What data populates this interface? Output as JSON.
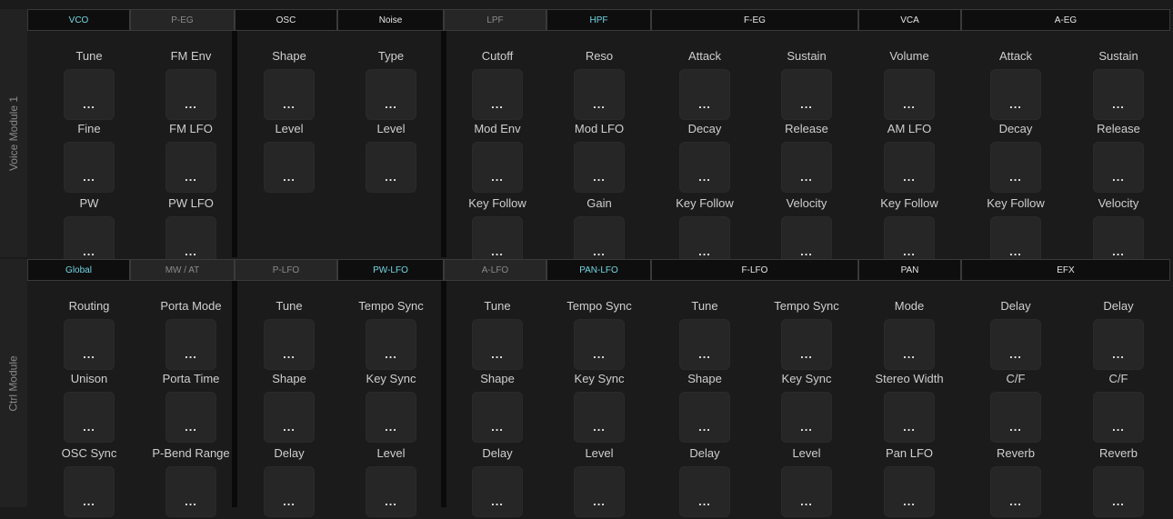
{
  "modules": [
    {
      "title": "Voice Module 1",
      "tabs": [
        {
          "label": "VCO",
          "style": "cyan"
        },
        {
          "label": "P-EG",
          "style": "dim"
        },
        {
          "label": "OSC",
          "style": "normal"
        },
        {
          "label": "Noise",
          "style": "normal"
        },
        {
          "label": "LPF",
          "style": "dim"
        },
        {
          "label": "HPF",
          "style": "cyan"
        },
        {
          "label": "F-EG",
          "style": "normal"
        },
        {
          "label": "VCA",
          "style": "normal"
        },
        {
          "label": "A-EG",
          "style": "normal"
        }
      ],
      "rows": [
        [
          "Tune",
          "FM Env",
          "Shape",
          "Type",
          "Cutoff",
          "Reso",
          "Attack",
          "Sustain",
          "Volume",
          "Attack",
          "Sustain"
        ],
        [
          "Fine",
          "FM LFO",
          "Level",
          "Level",
          "Mod Env",
          "Mod LFO",
          "Decay",
          "Release",
          "AM LFO",
          "Decay",
          "Release"
        ],
        [
          "PW",
          "PW LFO",
          "",
          "",
          "Key Follow",
          "Gain",
          "Key Follow",
          "Velocity",
          "Key Follow",
          "Key Follow",
          "Velocity"
        ]
      ]
    },
    {
      "title": "Ctrl Module",
      "tabs": [
        {
          "label": "Global",
          "style": "cyan"
        },
        {
          "label": "MW / AT",
          "style": "dim"
        },
        {
          "label": "P-LFO",
          "style": "dim"
        },
        {
          "label": "PW-LFO",
          "style": "cyan"
        },
        {
          "label": "A-LFO",
          "style": "dim"
        },
        {
          "label": "PAN-LFO",
          "style": "cyan"
        },
        {
          "label": "F-LFO",
          "style": "normal"
        },
        {
          "label": "PAN",
          "style": "normal"
        },
        {
          "label": "EFX",
          "style": "normal"
        }
      ],
      "rows": [
        [
          "Routing",
          "Porta Mode",
          "Tune",
          "Tempo Sync",
          "Tune",
          "Tempo Sync",
          "Tune",
          "Tempo Sync",
          "Mode",
          "Delay",
          "Delay"
        ],
        [
          "Unison",
          "Porta Time",
          "Shape",
          "Key Sync",
          "Shape",
          "Key Sync",
          "Shape",
          "Key Sync",
          "Stereo Width",
          "C/F",
          "C/F"
        ],
        [
          "OSC Sync",
          "P-Bend Range",
          "Delay",
          "Level",
          "Delay",
          "Level",
          "Delay",
          "Level",
          "Pan LFO",
          "Reverb",
          "Reverb"
        ]
      ]
    }
  ],
  "value_text": "..."
}
